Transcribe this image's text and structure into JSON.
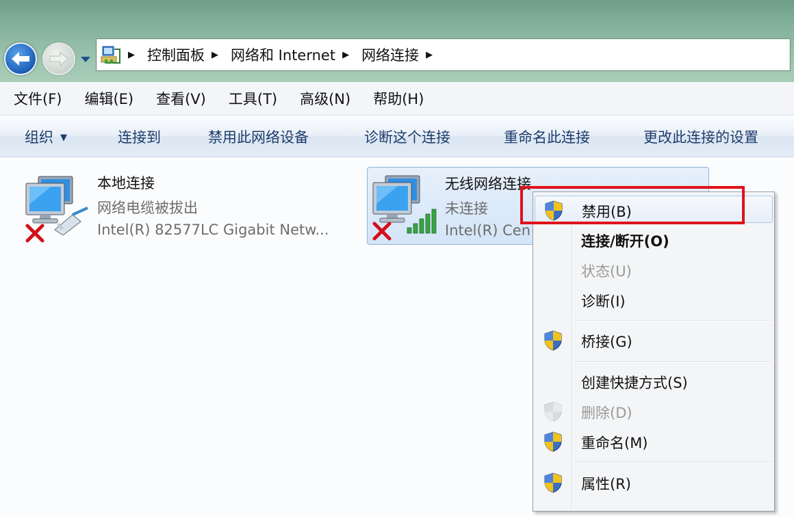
{
  "breadcrumb": [
    "控制面板",
    "网络和 Internet",
    "网络连接"
  ],
  "menubar": [
    "文件(F)",
    "编辑(E)",
    "查看(V)",
    "工具(T)",
    "高级(N)",
    "帮助(H)"
  ],
  "commands": {
    "organize": "组织",
    "connect_to": "连接到",
    "disable_device": "禁用此网络设备",
    "diagnose": "诊断这个连接",
    "rename": "重命名此连接",
    "change_settings": "更改此连接的设置"
  },
  "connections": [
    {
      "name": "本地连接",
      "status": "网络电缆被拔出",
      "device": "Intel(R) 82577LC Gigabit Netw..."
    },
    {
      "name": "无线网络连接",
      "status": "未连接",
      "device": "Intel(R) Cen"
    }
  ],
  "context_menu": [
    {
      "label": "禁用(B)",
      "shield": true,
      "enabled": true
    },
    {
      "label": "连接/断开(O)",
      "shield": false,
      "enabled": true,
      "bold": true
    },
    {
      "label": "状态(U)",
      "shield": false,
      "enabled": false
    },
    {
      "label": "诊断(I)",
      "shield": false,
      "enabled": true
    },
    {
      "label": "桥接(G)",
      "shield": true,
      "enabled": true
    },
    {
      "label": "创建快捷方式(S)",
      "shield": false,
      "enabled": true
    },
    {
      "label": "删除(D)",
      "shield": true,
      "enabled": false
    },
    {
      "label": "重命名(M)",
      "shield": true,
      "enabled": true
    },
    {
      "label": "属性(R)",
      "shield": true,
      "enabled": true
    }
  ],
  "colors": {
    "highlight_box": "#e0121a",
    "command_text": "#1d3c6b",
    "selection": "#d4e5f8"
  },
  "icons": [
    "back-arrow-icon",
    "forward-arrow-icon",
    "network-folder-icon",
    "computer-monitor-icon",
    "network-cable-icon",
    "wireless-signal-icon",
    "error-x-icon",
    "uac-shield-icon"
  ]
}
